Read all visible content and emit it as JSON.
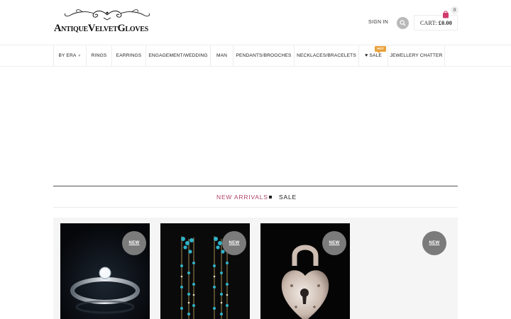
{
  "brand": {
    "name": "AntiqueVelvetGloves"
  },
  "header": {
    "signin_label": "SIGN IN",
    "cart_label": "CART:",
    "cart_total": "£0.00",
    "cart_count": "0",
    "search_icon": "search-icon",
    "cart_icon": "shopping-bag-icon"
  },
  "nav": {
    "items": [
      {
        "label": "BY ERA",
        "has_dropdown": true
      },
      {
        "label": "RINGS"
      },
      {
        "label": "EARRINGS"
      },
      {
        "label": "ENGAGEMENT/WEDDING"
      },
      {
        "label": "MAN"
      },
      {
        "label": "PENDANTS/BROOCHES"
      },
      {
        "label": "NECKLACES/BRACELETS"
      },
      {
        "label": "SALE",
        "icon": "heart-icon",
        "badge": "HOT"
      },
      {
        "label": "JEWELLERY CHATTER"
      }
    ],
    "hot_color": "#e9a13b"
  },
  "tabs": {
    "new_arrivals": "NEW ARRIVALS",
    "sale": "SALE",
    "active_color": "#b0466a"
  },
  "products": [
    {
      "badge": "NEW",
      "image": "diamond-ring"
    },
    {
      "badge": "NEW",
      "image": "turquoise-drop-earrings"
    },
    {
      "badge": "NEW",
      "image": "heart-padlock"
    },
    {
      "badge": "NEW",
      "image": "blank"
    }
  ]
}
